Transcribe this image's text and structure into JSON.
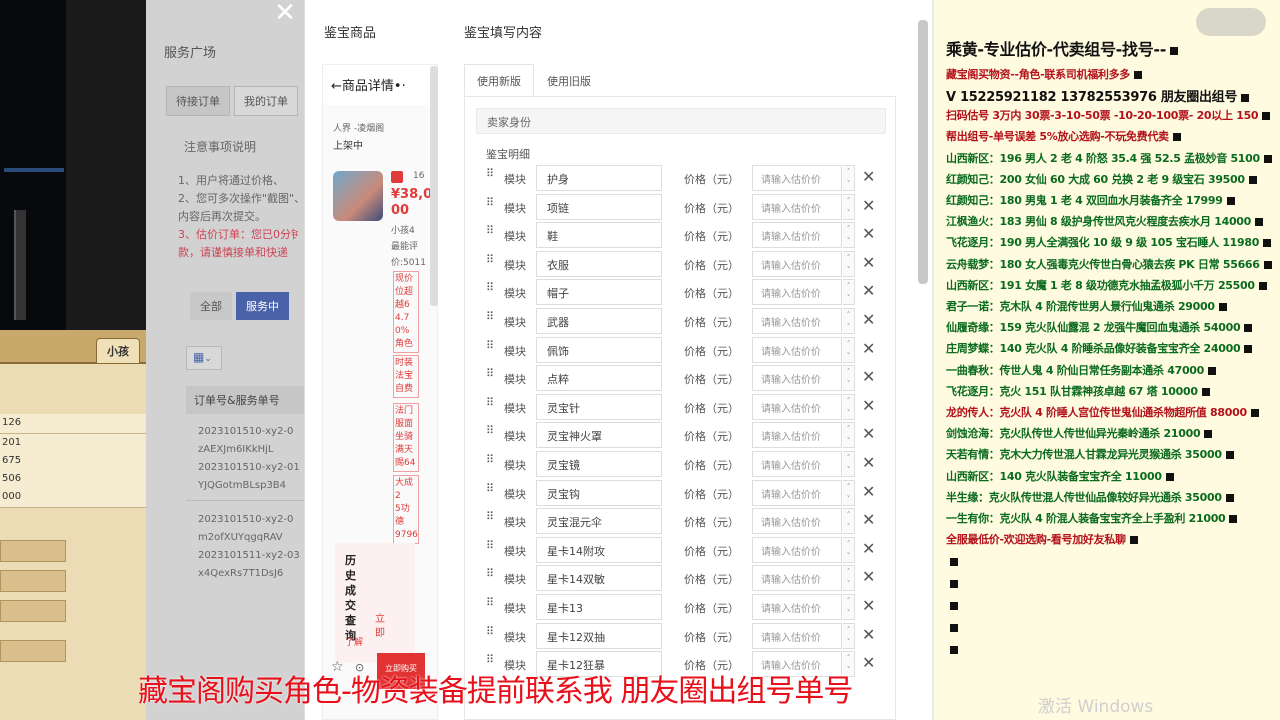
{
  "game": {
    "tab_label": "小孩",
    "numbers": [
      "126",
      "201",
      "675",
      "506",
      "000"
    ]
  },
  "page": {
    "title": "服务广场",
    "tabs": [
      "待接订单",
      "我的订单"
    ],
    "notice_title": "注意事项说明",
    "notes": [
      "1、用户将通过价格、",
      "2、您可多次操作\"截图\"、",
      "内容后再次提交。",
      "3、估价订单：您已0分钟",
      "款，请谨慎接单和快递"
    ],
    "filters": [
      "全部",
      "服务中"
    ],
    "table_header": "订单号&服务单号",
    "cells": [
      "2023101510-xy2-0",
      "zAEXJm6IKkHjL",
      "2023101510-xy2-01",
      "YJQGotmBLsp3B4",
      "2023101510-xy2-0",
      "m2ofXUYqgqRAV",
      "2023101511-xy2-03",
      "x4QexRs7T1DsJ6"
    ]
  },
  "modal": {
    "left_title": "鉴宝商品",
    "right_title": "鉴宝填写内容",
    "tabs": [
      "使用新版",
      "使用旧版"
    ],
    "seller_label": "卖家身份",
    "detail_label": "鉴宝明细",
    "product": {
      "header": "商品详情",
      "category": "人界 -凌烟阁",
      "status": "上架中",
      "price": "¥38,0",
      "price_suffix": "00",
      "count": "16",
      "side1": "小孩4",
      "side2": "最能评",
      "side3": "价:5011",
      "tags": [
        "现价",
        "位超",
        "越6",
        "4.7",
        "0%",
        "角色"
      ],
      "tags2": [
        "时装",
        "法宝",
        "自费"
      ],
      "tags3": [
        "法门",
        "服面",
        "坐骑",
        "满天",
        "赐64"
      ],
      "tags4": [
        "大成2",
        "5功德",
        "9796"
      ],
      "history_label": "历史成交查询",
      "history_sub": "了解",
      "buy_hint": "立即",
      "buy_button": "立即购买"
    },
    "module_label": "模块",
    "price_label": "价格（元）",
    "price_placeholder": "请输入估价价",
    "modules": [
      "护身",
      "项链",
      "鞋",
      "衣服",
      "帽子",
      "武器",
      "佩饰",
      "点粹",
      "灵宝针",
      "灵宝神火罩",
      "灵宝镜",
      "灵宝钩",
      "灵宝混元伞",
      "星卡14附攻",
      "星卡14双敏",
      "星卡13",
      "星卡12双抽",
      "星卡12狂暴"
    ]
  },
  "info": {
    "lines": [
      {
        "text": "乘黄-专业估价-代卖组号-找号--",
        "color": "#111111",
        "size": "big"
      },
      {
        "text": "藏宝阁买物资--角色-联系司机福利多多",
        "color": "#b3121b"
      },
      {
        "text": "V 15225921182    13782553976 朋友圈出组号",
        "color": "#111111",
        "size": "mid"
      },
      {
        "text": "扫码估号 3万内 30票-3-10-50票  -10-20-100票- 20以上 150",
        "color": "#b3121b"
      },
      {
        "text": "帮出组号-单号误差 5%放心选购-不玩免费代卖",
        "color": "#b3121b"
      },
      {
        "text": "山西新区：196 男人 2 老 4 阶怒 35.4 强 52.5 孟极妙音 5100",
        "color": "#0a6b1e"
      },
      {
        "text": "红颜知己：200 女仙 60 大成 60 兑换 2 老 9 级宝石 39500",
        "color": "#0a6b1e"
      },
      {
        "text": "红颜知己：180 男鬼 1 老 4 双回血水月装备齐全 17999",
        "color": "#0a6b1e"
      },
      {
        "text": "江枫渔火：183 男仙 8 级护身传世风克火程度去疾水月 14000",
        "color": "#0a6b1e"
      },
      {
        "text": "飞花逐月：190 男人全满强化 10 级 9 级 105 宝石睡人 11980",
        "color": "#0a6b1e"
      },
      {
        "text": "云舟载梦：180 女人强毒克火传世白骨心猿去疾 PK 日常 55666",
        "color": "#0a6b1e"
      },
      {
        "text": "山西新区：191 女魔 1 老 8 级功德克水抽孟极狐小千万 25500",
        "color": "#0a6b1e"
      },
      {
        "text": "君子一诺：克木队 4 阶混传世男人景行仙鬼通杀 29000",
        "color": "#0a6b1e"
      },
      {
        "text": "仙履奇缘：159 克火队仙露混 2 龙强牛魔回血鬼通杀 54000",
        "color": "#0a6b1e"
      },
      {
        "text": "庄周梦蝶：140 克火队 4 阶睡杀品像好装备宝宝齐全 24000",
        "color": "#0a6b1e"
      },
      {
        "text": "一曲春秋：传世人鬼 4 阶仙日常任务副本通杀 47000",
        "color": "#0a6b1e"
      },
      {
        "text": "飞花逐月：克火 151 队甘霖神孩卓越 67 塔 10000",
        "color": "#0a6b1e"
      },
      {
        "text": "龙的传人：克火队 4 阶睡人宫位传世鬼仙通杀物超所值 88000",
        "color": "#b3121b"
      },
      {
        "text": "剑蚀沧海：克火队传世人传世仙异光秦岭通杀 21000",
        "color": "#0a6b1e"
      },
      {
        "text": "天若有情：克木大力传世混人甘霖龙异光灵猴通杀 35000",
        "color": "#0a6b1e"
      },
      {
        "text": "山西新区：140 克火队装备宝宝齐全 11000",
        "color": "#0a6b1e"
      },
      {
        "text": "半生缘：克火队传世混人传世仙品像较好异光通杀 35000",
        "color": "#0a6b1e"
      },
      {
        "text": "一生有你：克火队 4 阶混人装备宝宝齐全上手盈利 21000",
        "color": "#0a6b1e"
      },
      {
        "text": "全服最低价-欢迎选购-看号加好友私聊",
        "color": "#b3121b"
      }
    ]
  },
  "caption": "藏宝阁购买角色-物资装备提前联系我      朋友圈出组号单号",
  "watermark": "激活 Windows"
}
